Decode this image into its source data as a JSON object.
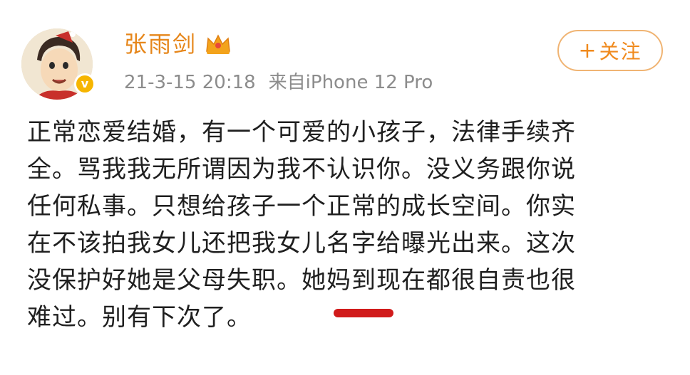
{
  "post": {
    "author": {
      "name": "张雨剑",
      "avatar_icon": "cartoon-avatar-icon",
      "badge_icon": "crown-badge-icon",
      "verified_icon": "verified-v-icon",
      "verified_label": "v"
    },
    "meta": {
      "time": "21-3-15 20:18",
      "source": "来自iPhone 12 Pro"
    },
    "follow_button": {
      "plus": "+",
      "label": "关注"
    },
    "content": {
      "lines": [
        "正常恋爱结婚，有一个可爱的小孩子，法律手续齐",
        "全。骂我我无所谓因为我不认识你。没义务跟你说",
        "任何私事。只想给孩子一个正常的成长空间。你实",
        "在不该拍我女儿还把我女儿名字给曝光出来。这次",
        "没保护好她是父母失职。她妈到现在都很自责也很",
        "难过。别有下次了。"
      ]
    },
    "annotation": {
      "type": "red-underline",
      "underlined_text": "她妈",
      "color": "#d11b1b"
    },
    "colors": {
      "username": "#e6861a",
      "follow": "#f08a1d",
      "meta": "#8c8c8c",
      "body": "#1f1f1f"
    }
  }
}
